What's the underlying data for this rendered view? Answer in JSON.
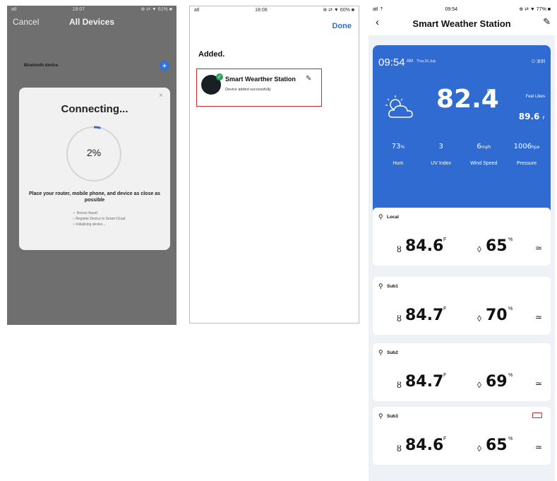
{
  "screen1": {
    "status": {
      "carrier": "atl",
      "time": "18:07",
      "right": "⊕ ⇄ ▼ 61% ■"
    },
    "nav": {
      "cancel": "Cancel",
      "title": "All Devices"
    },
    "row": {
      "label": "Bluetooth device",
      "plus_symbol": "+"
    },
    "dialog": {
      "close_symbol": "×",
      "heading": "Connecting...",
      "progress_percent": 2,
      "progress_text": "2%",
      "instruction": "Place your router, mobile phone, and device as close as possible",
      "steps": [
        "✓ Device found",
        "○ Register Device to Smart Cloud",
        "○ Initializing device..."
      ]
    }
  },
  "screen2": {
    "status": {
      "carrier": "atl",
      "time": "18:08",
      "right": "⊕ ⇄ ▼ 60% ■"
    },
    "done": "Done",
    "added": "Added.",
    "device": {
      "name": "Smart Wearther Station",
      "subtitle": "Device added successfully",
      "check_symbol": "✓",
      "edit_symbol": "✎"
    }
  },
  "screen3": {
    "status": {
      "carrier": "atl  ⇡",
      "time": "09:54",
      "right": "⊕ ⇄ ▼ 77% ■"
    },
    "nav": {
      "back": "‹",
      "title": "Smart Weather Station",
      "edit": "✎"
    },
    "hero": {
      "time": "09:54",
      "ampm": "AM",
      "date": "Thur,16,July",
      "location": "⊙ 深圳",
      "temp": "82.4",
      "temp_unit": "F",
      "feel_label": "Feel Likes",
      "feel_value": "89.6",
      "feel_unit": "F",
      "stats": [
        {
          "value": "73",
          "unit": "%",
          "label": "Hum"
        },
        {
          "value": "3",
          "unit": "",
          "label": "UV Index"
        },
        {
          "value": "6",
          "unit": "mph",
          "label": "Wind Speed"
        },
        {
          "value": "1006",
          "unit": "hpa",
          "label": "Pressure"
        }
      ]
    },
    "panels": [
      {
        "name": "Local",
        "temp": "84.6",
        "temp_unit": "F",
        "hum": "65",
        "hum_unit": "%"
      },
      {
        "name": "Sub1",
        "temp": "84.7",
        "temp_unit": "F",
        "hum": "70",
        "hum_unit": "%"
      },
      {
        "name": "Sub2",
        "temp": "84.7",
        "temp_unit": "F",
        "hum": "69",
        "hum_unit": "%"
      },
      {
        "name": "Sub3",
        "temp": "84.6",
        "temp_unit": "F",
        "hum": "65",
        "hum_unit": "%"
      }
    ],
    "icons": {
      "pin": "⚲",
      "temp_drop": "ȣ",
      "hum_drop": "◊",
      "trend": "≃"
    }
  },
  "colors": {
    "accent_blue": "#2f6bd0",
    "highlight_red": "#c8282f",
    "success_green": "#27a35a"
  }
}
